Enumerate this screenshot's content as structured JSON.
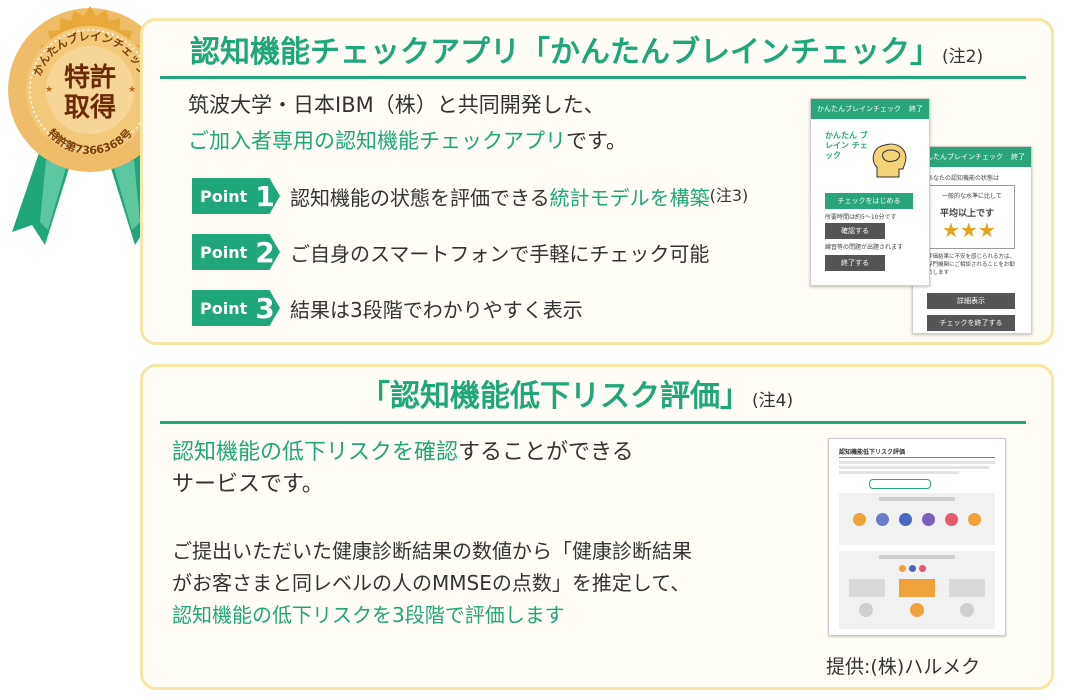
{
  "medal": {
    "arc_text": "かんたんブレインチェック",
    "main_line1": "特許",
    "main_line2": "取得",
    "patent_no": "特許第7366368号"
  },
  "app_section": {
    "title": "認知機能チェックアプリ「かんたんブレインチェック」",
    "title_note": "(注2)",
    "intro_line1": "筑波大学・日本IBM（株）と共同開発した、",
    "intro_line2_green": "ご加入者専用の認知機能チェックアプリ",
    "intro_line2_rest": "です。",
    "points": [
      {
        "label": "Point",
        "number": "1",
        "text_plain": "認知機能の状態を評価できる",
        "text_green": "統計モデルを構築",
        "note": "(注3)"
      },
      {
        "label": "Point",
        "number": "2",
        "text_plain": "ご自身のスマートフォンで手軽にチェック可能",
        "text_green": "",
        "note": ""
      },
      {
        "label": "Point",
        "number": "3",
        "text_plain": "結果は3段階でわかりやすく表示",
        "text_green": "",
        "note": ""
      }
    ],
    "phone1": {
      "bar_title": "かんたんブレインチェック",
      "bar_right": "終了",
      "bubble": "かんたん ブレイン チェック",
      "btn_start": "チェックをはじめる",
      "time_text": "所要時間は約5〜10分です",
      "btn_confirm": "確認する",
      "past_text": "練習等の問題が出題されます",
      "btn_end": "終了する"
    },
    "phone2": {
      "bar_title": "かんたんブレインチェック",
      "bar_right": "終了",
      "header_text": "あなたの認知機能の状態は",
      "box_small": "一般的な水準に比して",
      "box_big": "平均以上です",
      "stars": "★★★",
      "body_text": "評価結果に不安を感じられる方は、専門機関にご相談されることをお勧めします",
      "btn1": "詳細表示",
      "btn2": "チェックを終了する"
    }
  },
  "risk_section": {
    "title": "「認知機能低下リスク評価」",
    "title_note": "(注4)",
    "lead_green": "認知機能の低下リスクを確認",
    "lead_rest": "することができる",
    "lead_line2": "サービスです。",
    "desc_line1": "ご提出いただいた健康診断結果の数値から「健康診断結果",
    "desc_line2": "がお客さまと同レベルの人のMMSEの点数」を推定して、",
    "desc_line3_green": "認知機能の低下リスクを3段階で評価します",
    "doc_title": "認知機能低下リスク評価",
    "credit": "提供:(株)ハルメク"
  },
  "colors": {
    "accent_green": "#1fa67a",
    "card_border": "#f6e7a6",
    "medal_gold": "#e9a93a",
    "ribbon_green": "#1fa67a"
  }
}
